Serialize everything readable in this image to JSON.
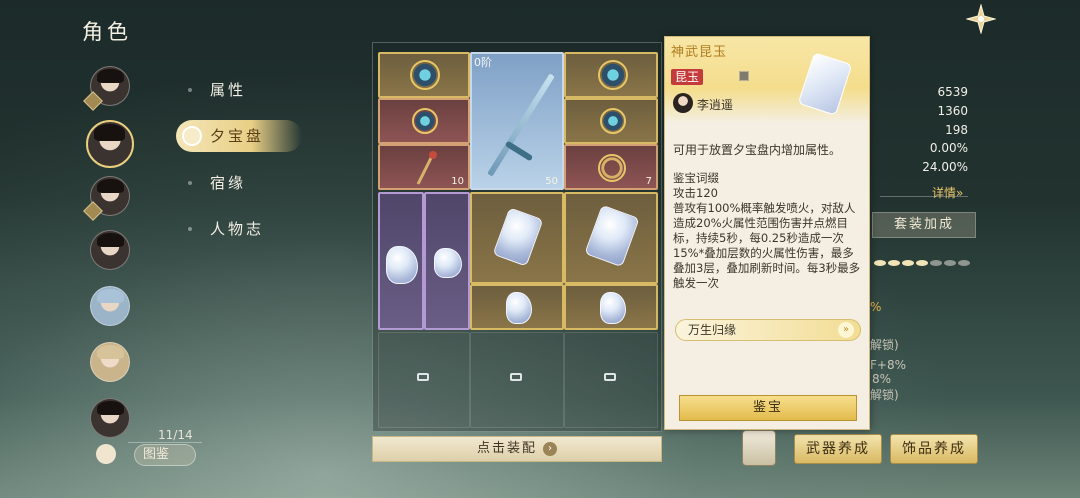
{
  "page": {
    "title": "角色"
  },
  "characters": {
    "count": "11/14",
    "tujian_label": "图鉴"
  },
  "tabs": [
    {
      "label": "属性"
    },
    {
      "label": "夕宝盘"
    },
    {
      "label": "宿缘"
    },
    {
      "label": "人物志"
    }
  ],
  "grid": {
    "tier_badge": "0阶",
    "counts": [
      "10",
      "50",
      "7"
    ],
    "equip_label": "点击装配"
  },
  "stats": {
    "values": [
      "6539",
      "1360",
      "198",
      "0.00%",
      "24.00%"
    ],
    "detail_link": "详情»",
    "set_bonus_label": "套装加成",
    "peek": [
      "%",
      "解锁)",
      "F+8%",
      "8%",
      "解锁)"
    ]
  },
  "buttons": {
    "weapon_train": "武器养成",
    "accessory_train": "饰品养成"
  },
  "tooltip": {
    "title": "神武昆玉",
    "tag": "昆玉",
    "owner": "李逍遥",
    "description": "可用于放置夕宝盘内增加属性。",
    "section_title": "鉴宝词缀",
    "attack": "攻击120",
    "effect": "普攻有100%概率触发喷火，对敌人造成20%火属性范围伤害并点燃目标，持续5秒，每0.25秒造成一次15%*叠加层数的火属性伤害，最多叠加3层，叠加刷新时间。每3秒最多触发一次",
    "affix": "万生归缘",
    "appraise_label": "鉴宝"
  },
  "colors": {
    "gold_border": "#d8b964",
    "highlight_green": "#2a9a7e",
    "tooltip_title": "#b17d1f",
    "tag_red": "#c53a3a"
  }
}
